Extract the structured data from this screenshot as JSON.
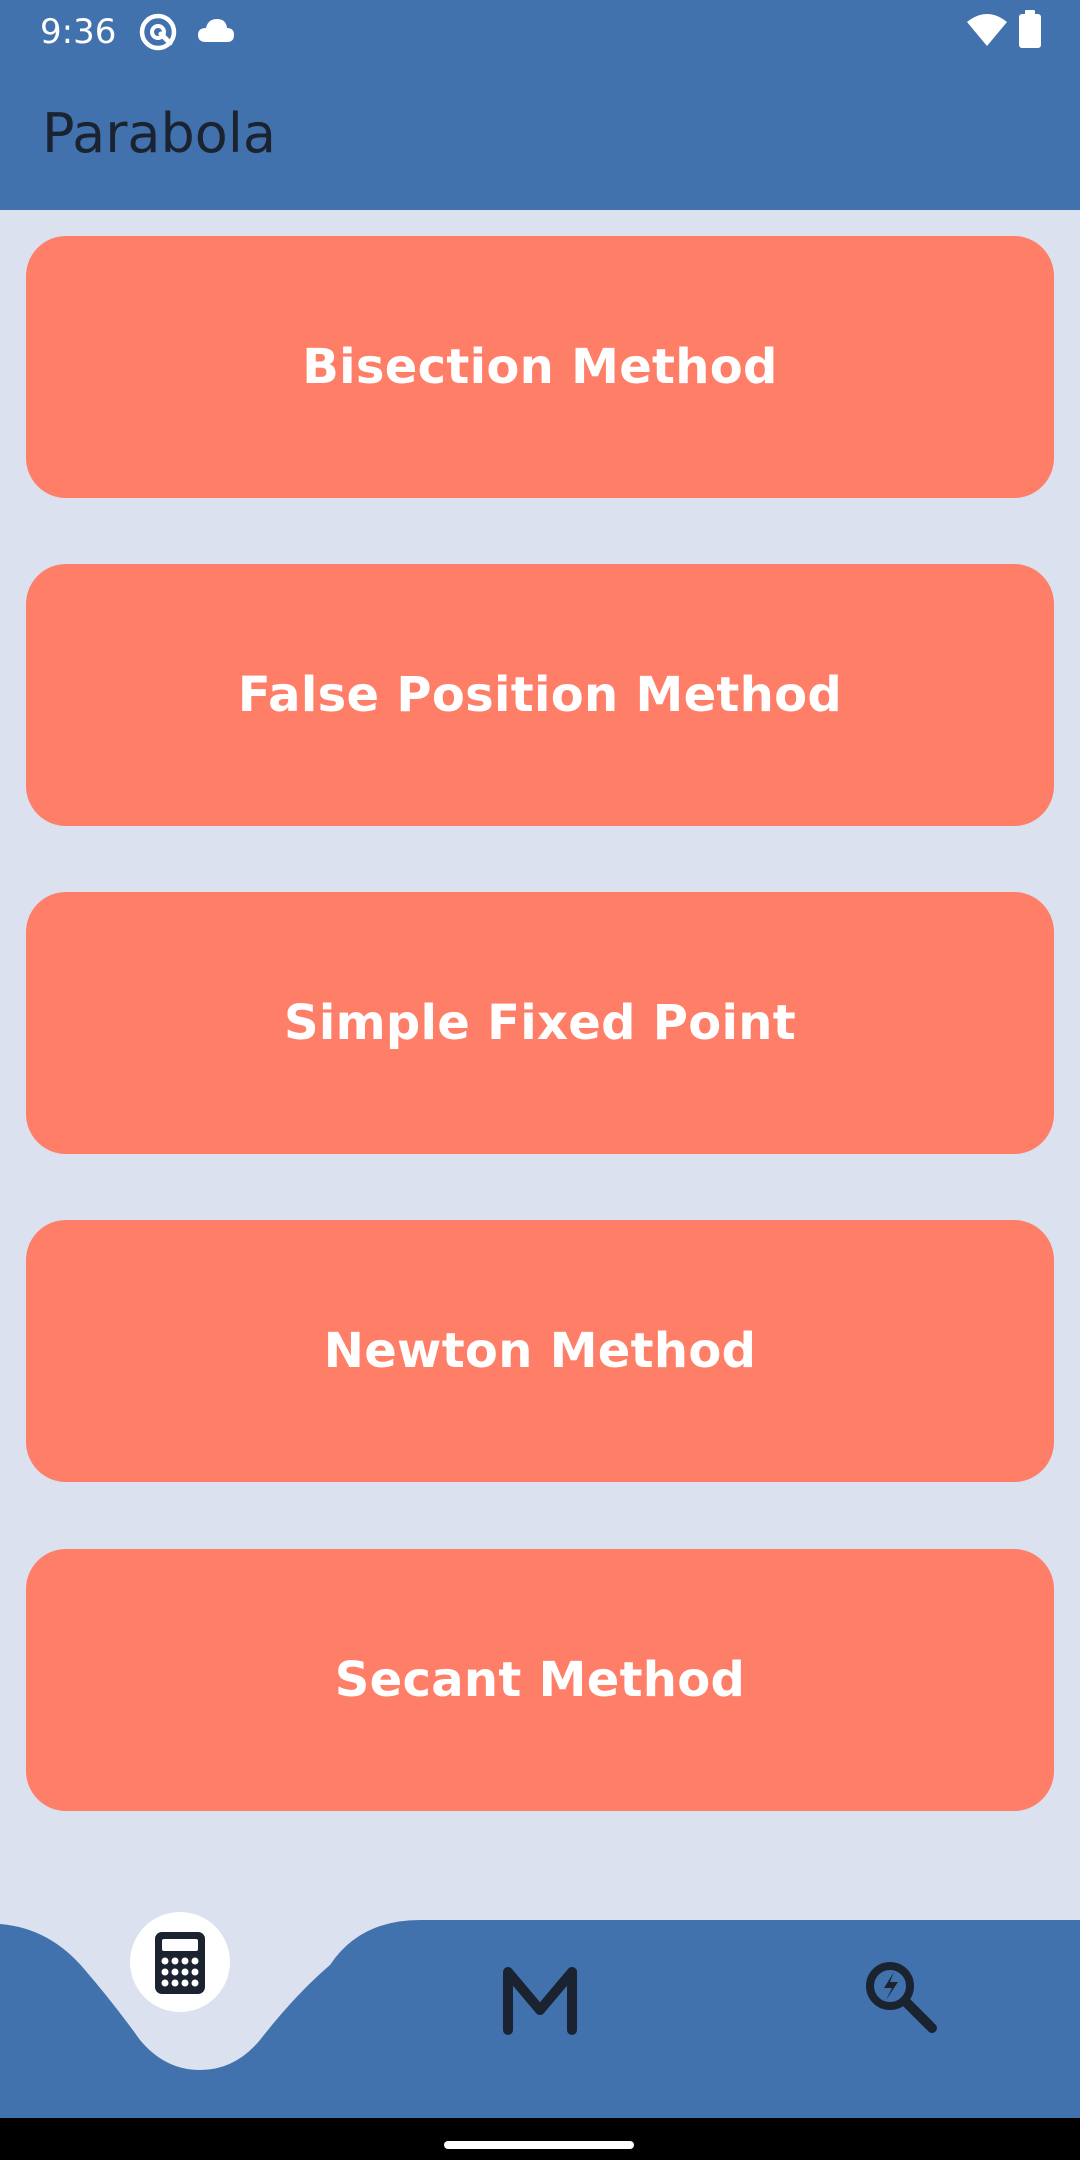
{
  "status_bar": {
    "time": "9:36",
    "icons": [
      "at-sign-icon",
      "cloud-icon",
      "wifi-icon",
      "battery-icon"
    ]
  },
  "app_bar": {
    "title": "Parabola"
  },
  "methods": [
    {
      "label": "Bisection Method"
    },
    {
      "label": "False Position Method"
    },
    {
      "label": "Simple Fixed Point"
    },
    {
      "label": "Newton Method"
    },
    {
      "label": "Secant Method"
    }
  ],
  "bottom_nav": {
    "items": [
      {
        "icon": "calculator-icon",
        "selected": true
      },
      {
        "icon": "m-icon",
        "selected": false
      },
      {
        "icon": "search-bolt-icon",
        "selected": false
      }
    ]
  },
  "colors": {
    "primary": "#4172ae",
    "background": "#dbe1ef",
    "button": "#fe7e68",
    "text_dark": "#1b2331"
  }
}
